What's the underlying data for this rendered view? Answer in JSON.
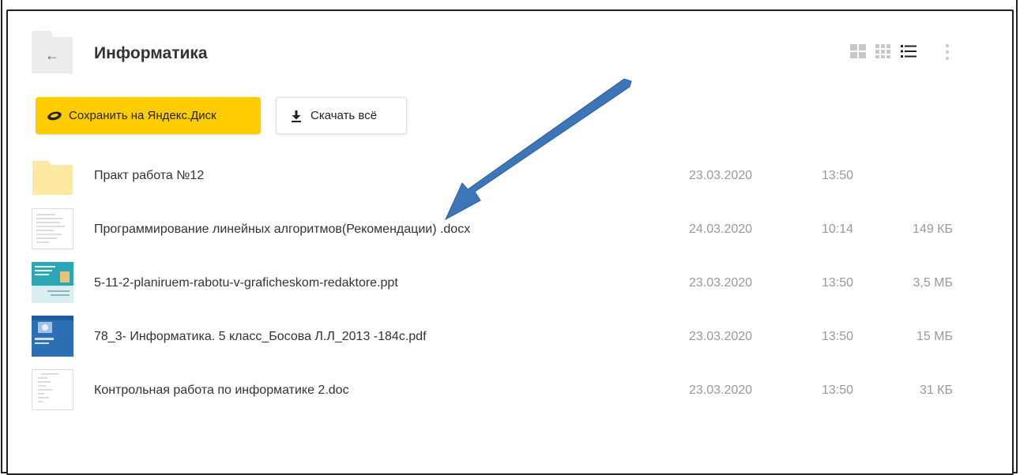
{
  "header": {
    "back_icon": "←",
    "title": "Информатика"
  },
  "actions": {
    "save_label": "Сохранить на Яндекс.Диск",
    "download_label": "Скачать всё"
  },
  "view_modes": [
    "large-tiles",
    "small-tiles",
    "list"
  ],
  "selected_view": "list",
  "colors": {
    "save_button": "#ffcc00",
    "folder": "#fce9a6",
    "annotation_arrow": "#3a74b8"
  },
  "files": [
    {
      "type": "folder",
      "name": "Практ работа №12",
      "date": "23.03.2020",
      "time": "13:50",
      "size": ""
    },
    {
      "type": "docx",
      "name": "Программирование линейных алгоритмов(Рекомендации) .docx",
      "date": "24.03.2020",
      "time": "10:14",
      "size": "149 КБ"
    },
    {
      "type": "ppt",
      "name": "5-11-2-planiruem-rabotu-v-graficheskom-redaktore.ppt",
      "date": "23.03.2020",
      "time": "13:50",
      "size": "3,5 МБ"
    },
    {
      "type": "pdf",
      "name": "78_3- Информатика. 5 класс_Босова Л.Л_2013 -184с.pdf",
      "date": "23.03.2020",
      "time": "13:50",
      "size": "15 МБ"
    },
    {
      "type": "doc",
      "name": "Контрольная работа по информатике 2.doc",
      "date": "23.03.2020",
      "time": "13:50",
      "size": "31 КБ"
    }
  ]
}
